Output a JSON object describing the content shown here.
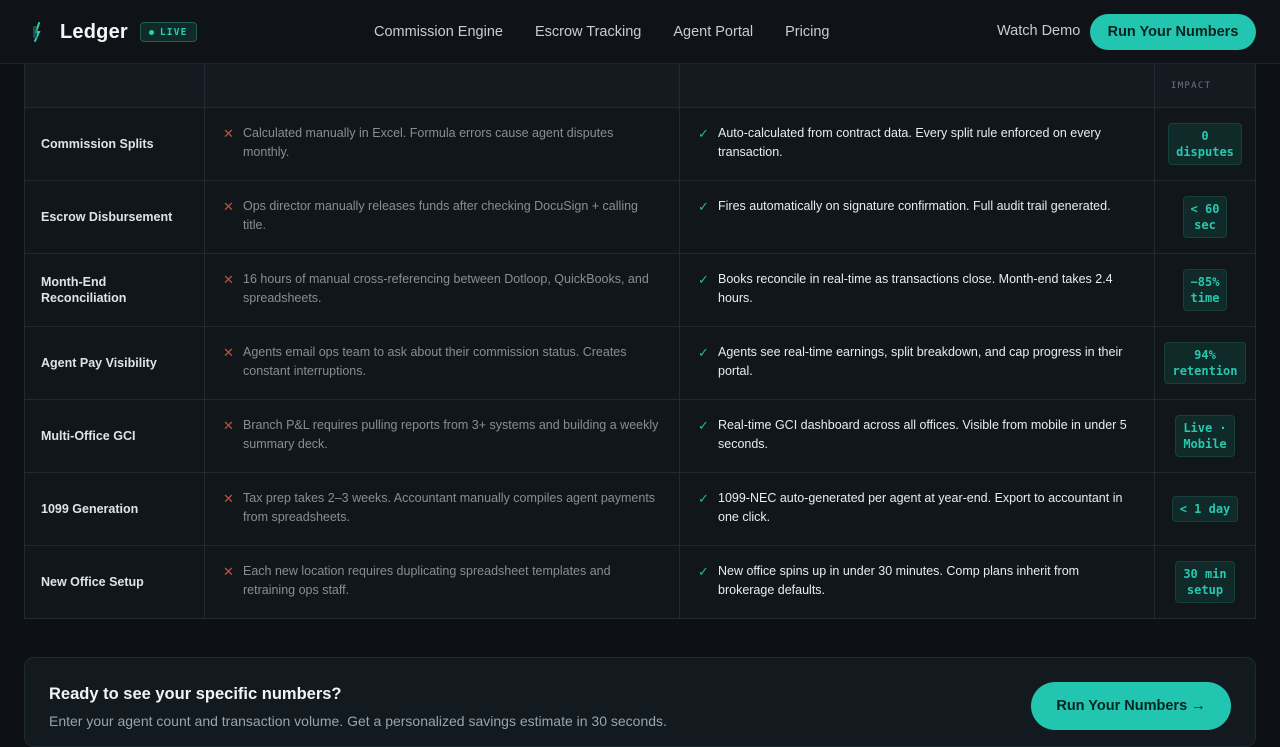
{
  "brand": {
    "name": "Ledger",
    "badge": "LIVE"
  },
  "nav": {
    "links": [
      "Commission Engine",
      "Escrow Tracking",
      "Agent Portal",
      "Pricing"
    ],
    "watch_demo": "Watch Demo",
    "cta": "Run Your Numbers"
  },
  "table": {
    "impact_header": "IMPACT",
    "rows": [
      {
        "feature": "Commission Splits",
        "old": "Calculated manually in Excel. Formula errors cause agent disputes monthly.",
        "new": "Auto-calculated from contract data. Every split rule enforced on every transaction.",
        "impact": "0\ndisputes"
      },
      {
        "feature": "Escrow Disbursement",
        "old": "Ops director manually releases funds after checking DocuSign + calling title.",
        "new": "Fires automatically on signature confirmation. Full audit trail generated.",
        "impact": "< 60\nsec"
      },
      {
        "feature": "Month-End Reconciliation",
        "old": "16 hours of manual cross-referencing between Dotloop, QuickBooks, and spreadsheets.",
        "new": "Books reconcile in real-time as transactions close. Month-end takes 2.4 hours.",
        "impact": "−85%\ntime"
      },
      {
        "feature": "Agent Pay Visibility",
        "old": "Agents email ops team to ask about their commission status. Creates constant interruptions.",
        "new": "Agents see real-time earnings, split breakdown, and cap progress in their portal.",
        "impact": "94%\nretention"
      },
      {
        "feature": "Multi-Office GCI",
        "old": "Branch P&L requires pulling reports from 3+ systems and building a weekly summary deck.",
        "new": "Real-time GCI dashboard across all offices. Visible from mobile in under 5 seconds.",
        "impact": "Live ·\nMobile"
      },
      {
        "feature": "1099 Generation",
        "old": "Tax prep takes 2–3 weeks. Accountant manually compiles agent payments from spreadsheets.",
        "new": "1099-NEC auto-generated per agent at year-end. Export to accountant in one click.",
        "impact": "< 1 day"
      },
      {
        "feature": "New Office Setup",
        "old": "Each new location requires duplicating spreadsheet templates and retraining ops staff.",
        "new": "New office spins up in under 30 minutes. Comp plans inherit from brokerage defaults.",
        "impact": "30 min\nsetup"
      }
    ]
  },
  "cta_panel": {
    "title": "Ready to see your specific numbers?",
    "subtitle": "Enter your agent count and transaction volume. Get a personalized savings estimate in 30 seconds.",
    "button": "Run Your Numbers →"
  },
  "colors": {
    "accent": "#22c5b0",
    "negative": "#c2503f",
    "background": "#0d1014"
  }
}
